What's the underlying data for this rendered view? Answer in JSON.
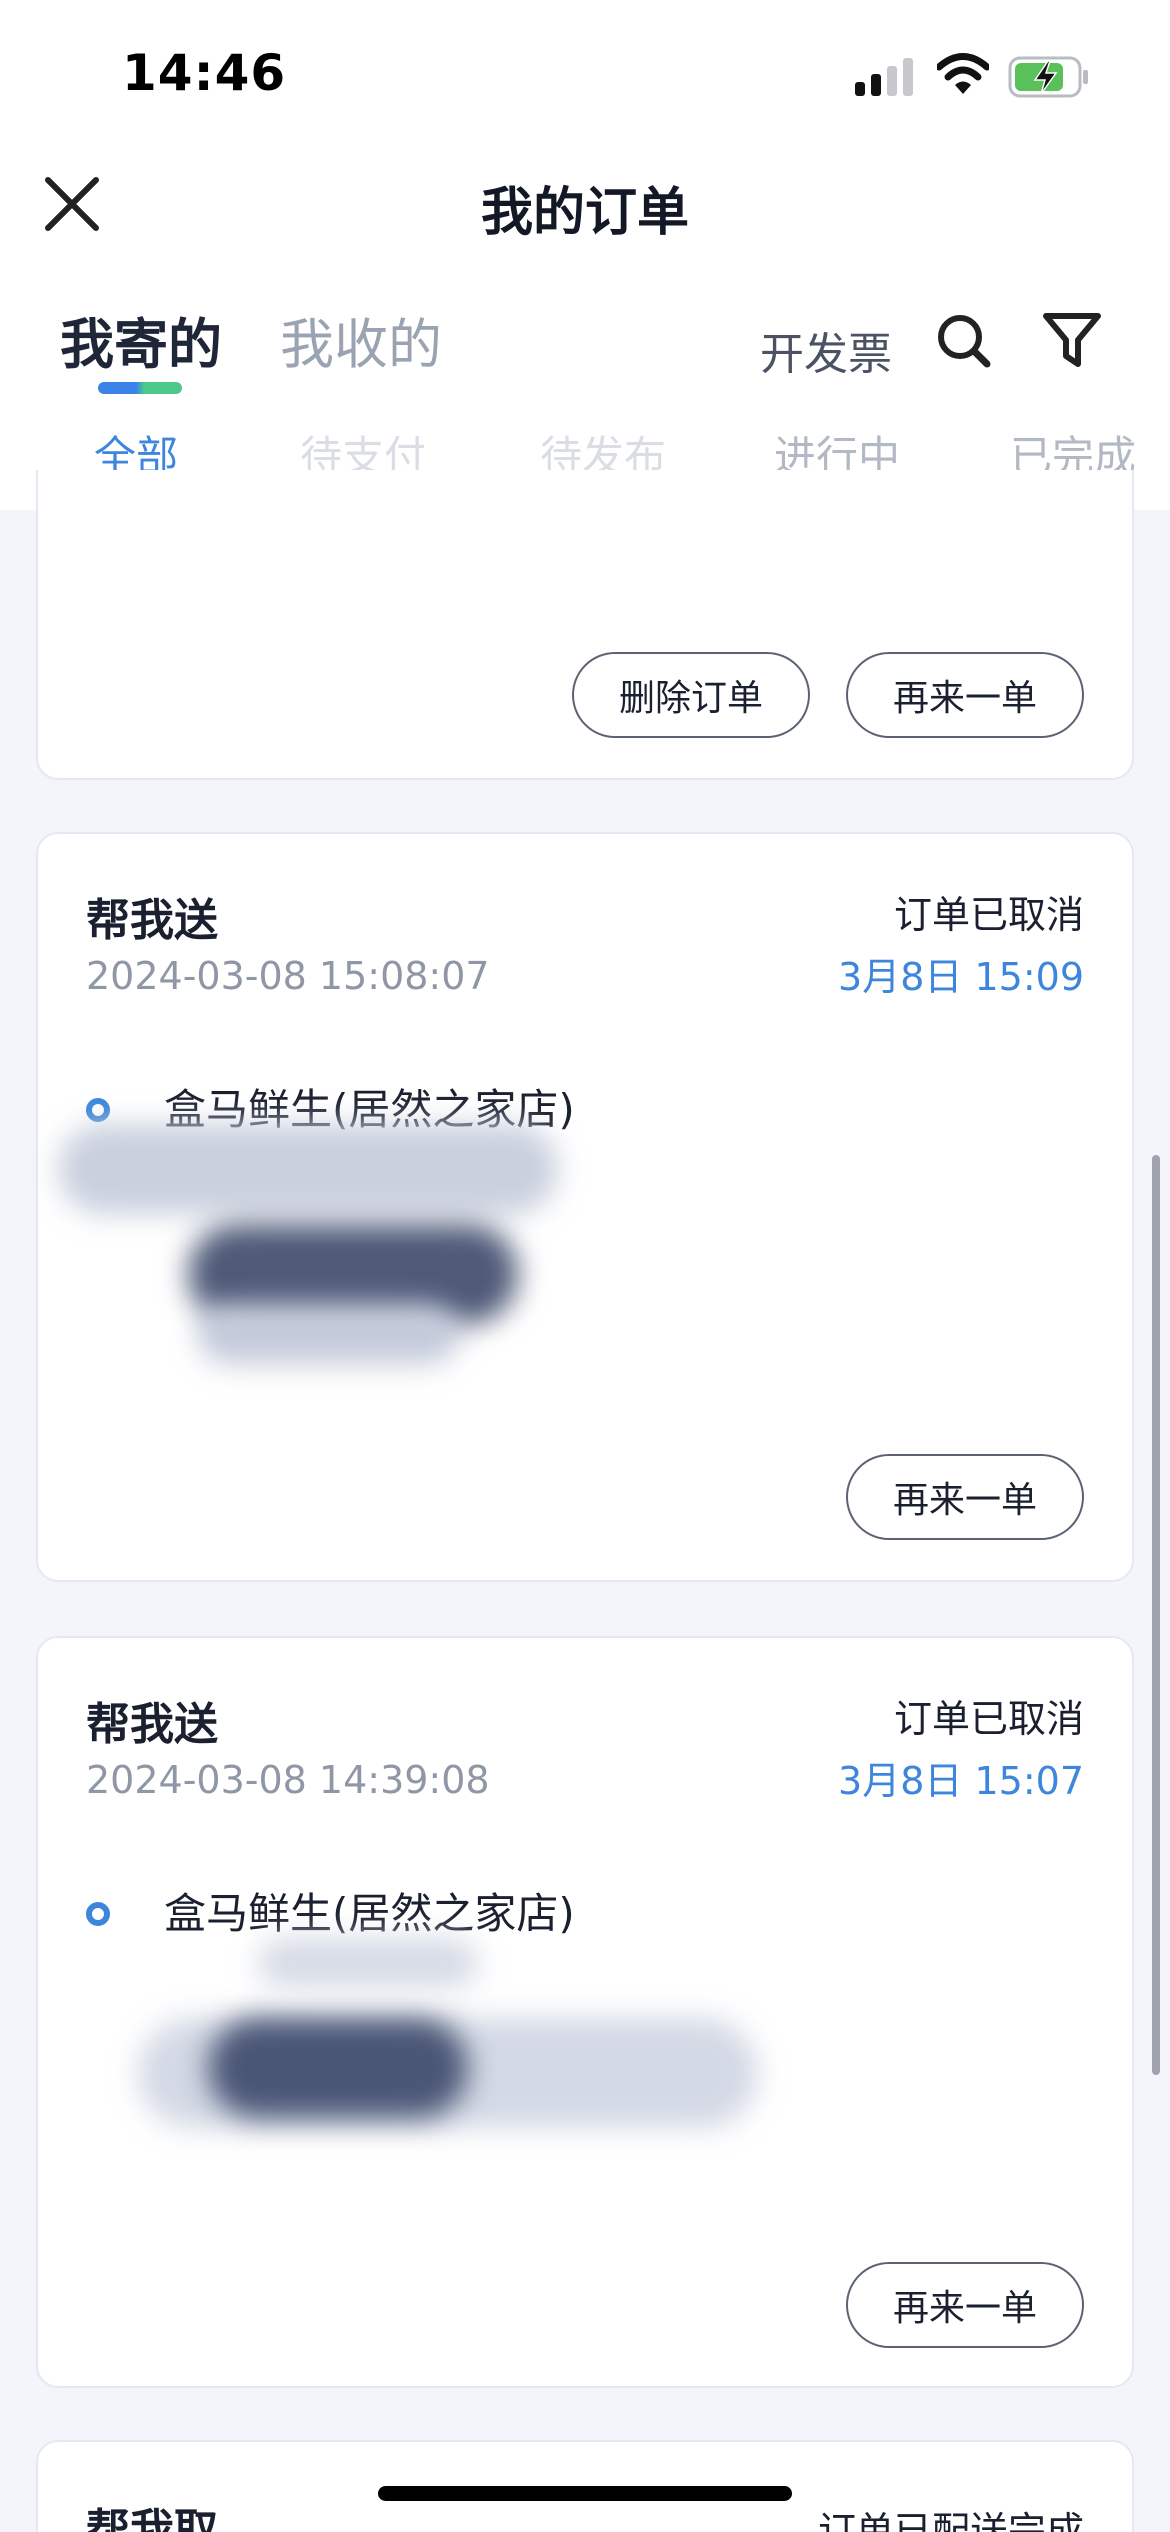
{
  "status_bar": {
    "time": "14:46"
  },
  "header": {
    "title": "我的订单"
  },
  "tabs": {
    "sent": "我寄的",
    "received": "我收的",
    "invoice": "开发票"
  },
  "sub_tabs": {
    "all": "全部",
    "pending_payment": "待支付",
    "pending_publish": "待发布",
    "in_progress": "进行中",
    "completed": "已完成"
  },
  "cards": [
    {
      "buttons": {
        "delete": "删除订单",
        "reorder": "再来一单"
      }
    },
    {
      "type": "帮我送",
      "created_at": "2024-03-08 15:08:07",
      "status": "订单已取消",
      "status_time": "3月8日 15:09",
      "pickup": "盒马鲜生(居然之家店)",
      "buttons": {
        "reorder": "再来一单"
      }
    },
    {
      "type": "帮我送",
      "created_at": "2024-03-08 14:39:08",
      "status": "订单已取消",
      "status_time": "3月8日 15:07",
      "pickup": "盒马鲜生(居然之家店)",
      "buttons": {
        "reorder": "再来一单"
      }
    },
    {
      "type": "帮我取",
      "status": "订单已配送完成"
    }
  ],
  "colors": {
    "accent": "#3d86dc",
    "indicator_green": "#4cc98a",
    "battery_green": "#5ac05a"
  },
  "icons": [
    "signal-icon",
    "wifi-icon",
    "battery-charging-icon",
    "close-icon",
    "search-icon",
    "filter-icon"
  ]
}
